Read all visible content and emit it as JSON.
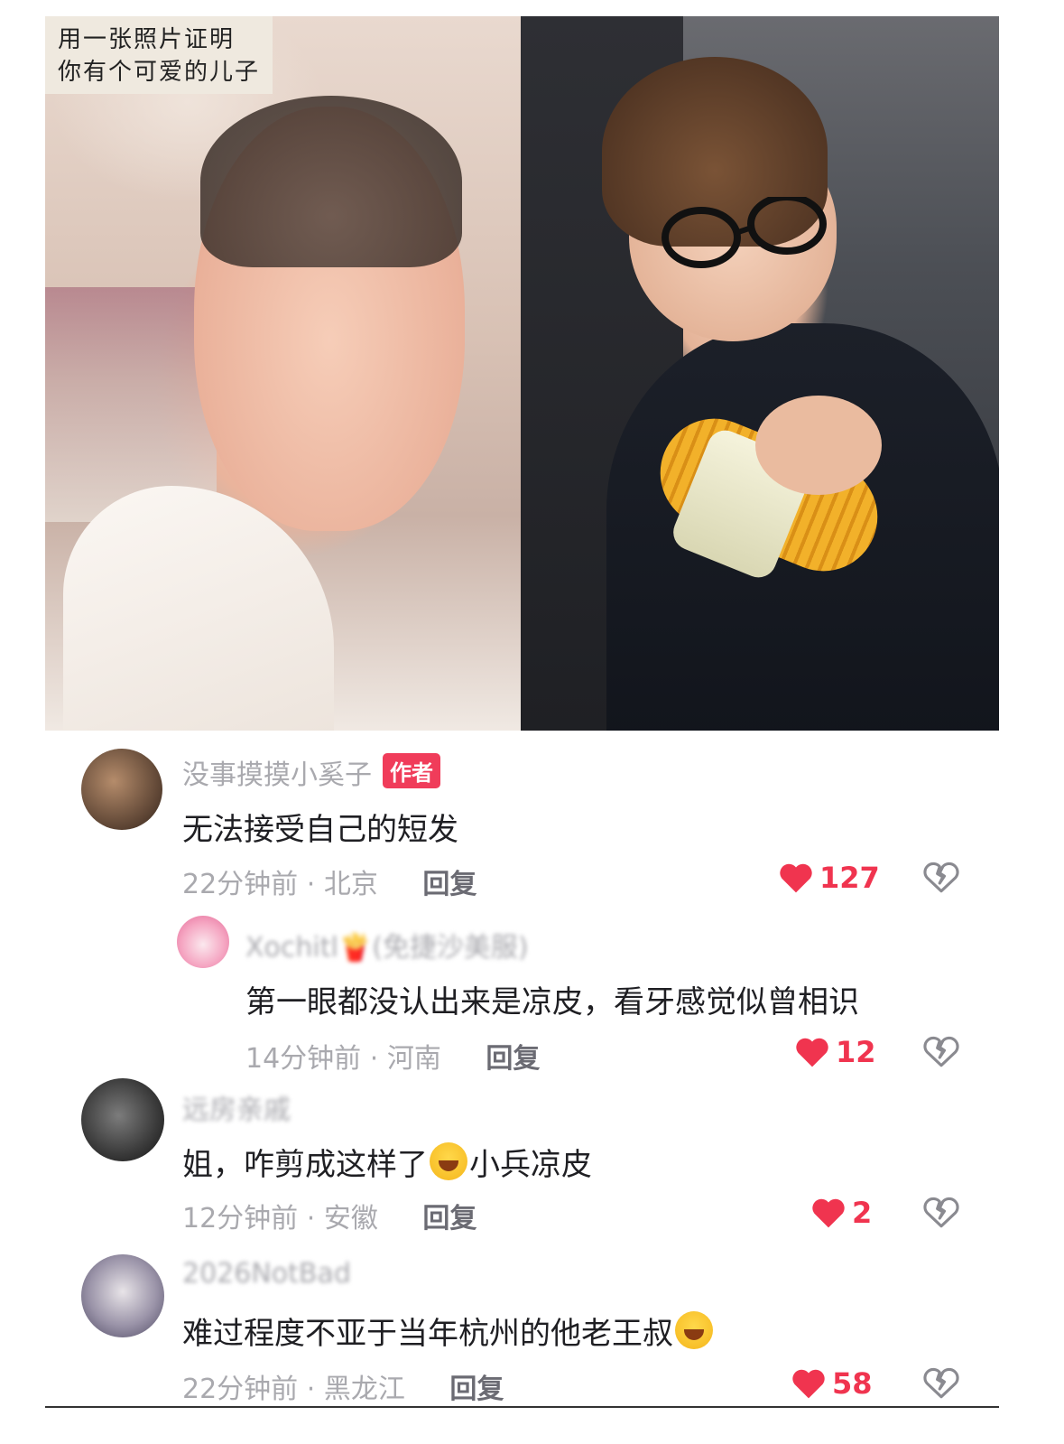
{
  "photo_caption": {
    "line1": "用一张照片证明",
    "line2": "你有个可爱的儿子"
  },
  "comments": [
    {
      "username": "没事摸摸小奚子",
      "badge": "作者",
      "text": "无法接受自己的短发",
      "time": "22分钟前",
      "location": "北京",
      "reply_label": "回复",
      "likes": "127"
    },
    {
      "username": "Xochitl🍟(免捷沙美服)",
      "text": "第一眼都没认出来是凉皮，看牙感觉似曾相识",
      "time": "14分钟前",
      "location": "河南",
      "reply_label": "回复",
      "likes": "12"
    },
    {
      "username": "远房亲戚",
      "text_before": "姐，咋剪成这样了",
      "text_after": "小兵凉皮",
      "time": "12分钟前",
      "location": "安徽",
      "reply_label": "回复",
      "likes": "2"
    },
    {
      "username": "2026NotBad",
      "text_before": "难过程度不亚于当年杭州的他老王叔",
      "time": "22分钟前",
      "location": "黑龙江",
      "reply_label": "回复",
      "likes": "58"
    }
  ],
  "separator": "·",
  "colors": {
    "like_red": "#f0344f",
    "author_badge": "#f03c5a",
    "meta_gray": "#a9a9ae"
  }
}
